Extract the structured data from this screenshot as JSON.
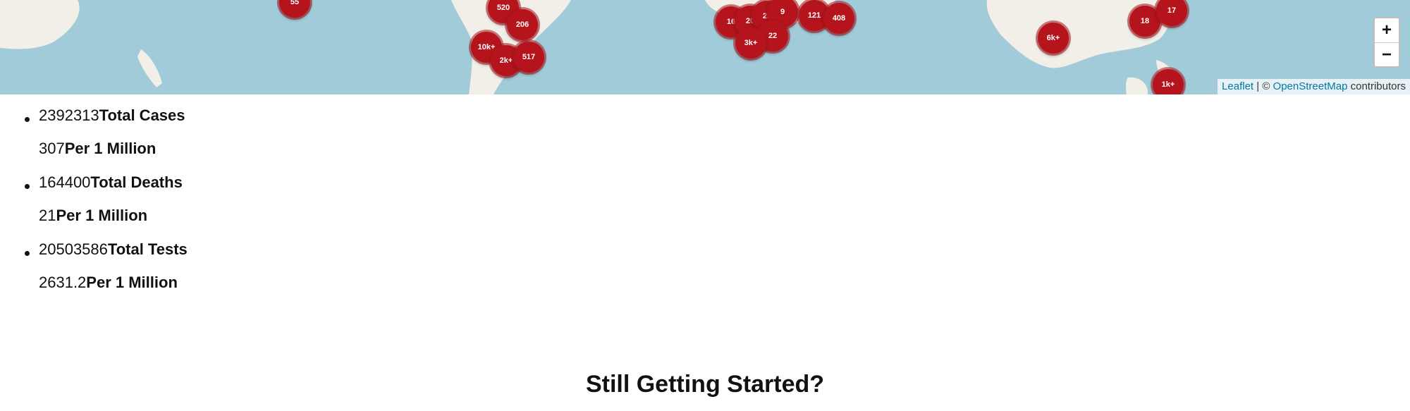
{
  "map": {
    "clusters": [
      "55",
      "520",
      "206",
      "10k+",
      "2k+",
      "517",
      "16",
      "20",
      "25",
      "9",
      "22",
      "3k+",
      "121",
      "408",
      "6k+",
      "18",
      "17",
      "1k+"
    ],
    "zoom_in": "+",
    "zoom_out": "−",
    "attribution": {
      "leaflet": "Leaflet",
      "separator": " | © ",
      "osm": "OpenStreetMap",
      "suffix": " contributors"
    }
  },
  "stats": [
    {
      "value": "2392313",
      "label": "Total Cases",
      "per_value": "307",
      "per_label": "Per 1 Million"
    },
    {
      "value": "164400",
      "label": "Total Deaths",
      "per_value": "21",
      "per_label": "Per 1 Million"
    },
    {
      "value": "20503586",
      "label": "Total Tests",
      "per_value": "2631.2",
      "per_label": "Per 1 Million"
    }
  ],
  "cta": {
    "title": "Still Getting Started?"
  },
  "colors": {
    "water": "#a2cbd9",
    "land": "#f2efe9",
    "marker": "#b5141d"
  }
}
